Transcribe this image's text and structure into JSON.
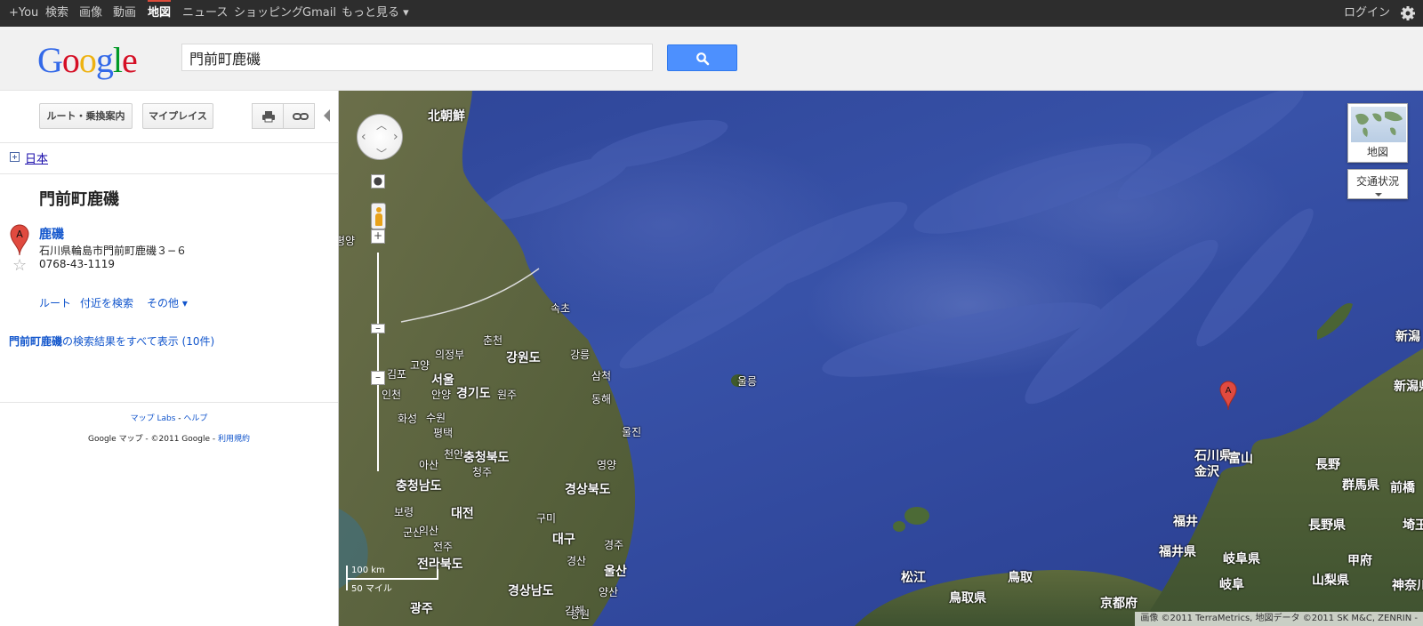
{
  "topbar": {
    "items": [
      "+You",
      "検索",
      "画像",
      "動画",
      "地図",
      "ニュース",
      "ショッピング",
      "Gmail",
      "もっと見る ▾"
    ],
    "active_index": 4,
    "login": "ログイン"
  },
  "header": {
    "logo_letters": [
      {
        "ch": "G",
        "color": "#3369e8"
      },
      {
        "ch": "o",
        "color": "#d50f25"
      },
      {
        "ch": "o",
        "color": "#eeb211"
      },
      {
        "ch": "g",
        "color": "#3369e8"
      },
      {
        "ch": "l",
        "color": "#009925"
      },
      {
        "ch": "e",
        "color": "#d50f25"
      }
    ],
    "search_value": "門前町鹿磯",
    "search_button_icon": "search-icon"
  },
  "left": {
    "route_button": "ルート・乗換案内",
    "myplaces_button": "マイプレイス",
    "print_icon": "print-icon",
    "link_icon": "link-icon",
    "country_link": "日本",
    "place_title": "門前町鹿磯",
    "result": {
      "marker_letter": "A",
      "name": "鹿磯",
      "address": "石川県輪島市門前町鹿磯３−６",
      "phone": "0768-43-1119"
    },
    "actions": [
      "ルート",
      "付近を検索",
      "その他 ▾"
    ],
    "all_results_query": "門前町鹿磯",
    "all_results_text": "の検索結果をすべて表示 (10件)",
    "footer_labs": "マップ Labs",
    "footer_sep": " - ",
    "footer_help": "ヘルプ",
    "footer_copyright": "Google マップ - ©2011 Google - ",
    "footer_terms": "利用規約"
  },
  "map": {
    "maptype_label": "地図",
    "traffic_label": "交通状況",
    "scale_km": "100 km",
    "scale_mi": "50 マイル",
    "attribution": "画像 ©2011 TerraMetrics, 地図データ ©2011 SK M&C, ZENRIN -",
    "marker_letter": "A",
    "labels": [
      {
        "text": "北朝鮮",
        "big": true
      },
      {
        "text": "평양",
        "big": false
      },
      {
        "text": "속초",
        "big": false
      },
      {
        "text": "강원도",
        "big": true
      },
      {
        "text": "춘천",
        "big": false
      },
      {
        "text": "강릉",
        "big": false
      },
      {
        "text": "의정부",
        "big": false
      },
      {
        "text": "고양",
        "big": false
      },
      {
        "text": "김포",
        "big": false
      },
      {
        "text": "서울",
        "big": true
      },
      {
        "text": "인천",
        "big": false
      },
      {
        "text": "안양",
        "big": false
      },
      {
        "text": "경기도",
        "big": true
      },
      {
        "text": "원주",
        "big": false
      },
      {
        "text": "삼척",
        "big": false
      },
      {
        "text": "동해",
        "big": false
      },
      {
        "text": "수원",
        "big": false
      },
      {
        "text": "화성",
        "big": false
      },
      {
        "text": "평택",
        "big": false
      },
      {
        "text": "천안",
        "big": false
      },
      {
        "text": "충청북도",
        "big": true
      },
      {
        "text": "아산",
        "big": false
      },
      {
        "text": "청주",
        "big": false
      },
      {
        "text": "울진",
        "big": false
      },
      {
        "text": "영양",
        "big": false
      },
      {
        "text": "충청남도",
        "big": true
      },
      {
        "text": "경상북도",
        "big": true
      },
      {
        "text": "대전",
        "big": true
      },
      {
        "text": "보령",
        "big": false
      },
      {
        "text": "구미",
        "big": false
      },
      {
        "text": "군산",
        "big": false
      },
      {
        "text": "익산",
        "big": false
      },
      {
        "text": "대구",
        "big": true
      },
      {
        "text": "전주",
        "big": false
      },
      {
        "text": "경주",
        "big": false
      },
      {
        "text": "전라북도",
        "big": true
      },
      {
        "text": "경산",
        "big": false
      },
      {
        "text": "울산",
        "big": true
      },
      {
        "text": "경상남도",
        "big": true
      },
      {
        "text": "양산",
        "big": false
      },
      {
        "text": "창원",
        "big": false
      },
      {
        "text": "김해",
        "big": false
      },
      {
        "text": "광주",
        "big": true
      },
      {
        "text": "울릉",
        "big": false
      },
      {
        "text": "新潟",
        "big": true
      },
      {
        "text": "新潟県",
        "big": true
      },
      {
        "text": "石川県",
        "big": true
      },
      {
        "text": "金沢",
        "big": true
      },
      {
        "text": "富山",
        "big": true
      },
      {
        "text": "長野",
        "big": true
      },
      {
        "text": "群馬県",
        "big": true
      },
      {
        "text": "前橋",
        "big": true
      },
      {
        "text": "福井",
        "big": true
      },
      {
        "text": "長野県",
        "big": true
      },
      {
        "text": "埼玉県",
        "big": true
      },
      {
        "text": "福井県",
        "big": true
      },
      {
        "text": "岐阜県",
        "big": true
      },
      {
        "text": "甲府",
        "big": true
      },
      {
        "text": "山梨県",
        "big": true
      },
      {
        "text": "神奈川",
        "big": true
      },
      {
        "text": "岐阜",
        "big": true
      },
      {
        "text": "松江",
        "big": true
      },
      {
        "text": "鳥取",
        "big": true
      },
      {
        "text": "鳥取県",
        "big": true
      },
      {
        "text": "京都府",
        "big": true
      }
    ]
  }
}
